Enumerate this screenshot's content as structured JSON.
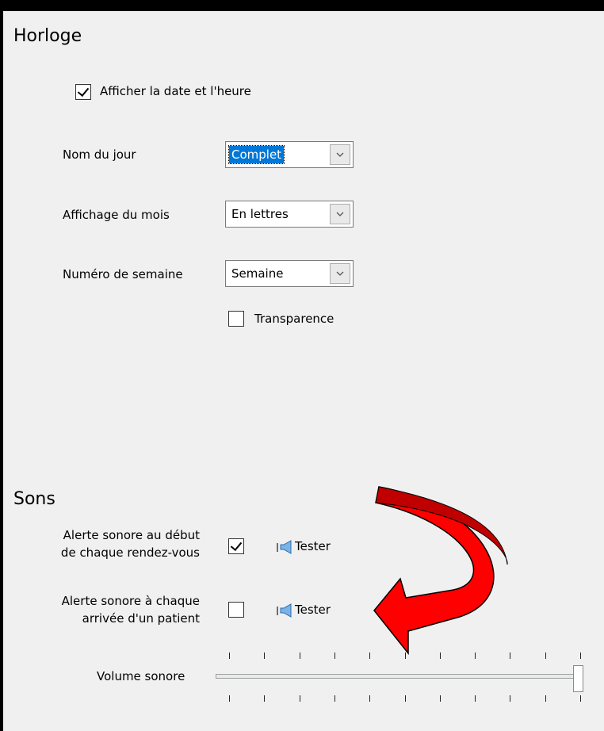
{
  "clock": {
    "title": "Horloge",
    "show_datetime_label": "Afficher la date et l'heure",
    "show_datetime_checked": true,
    "day_name_label": "Nom du jour",
    "day_name_value": "Complet",
    "month_label": "Affichage du mois",
    "month_value": "En lettres",
    "week_label": "Numéro de semaine",
    "week_value": "Semaine",
    "transparency_label": "Transparence",
    "transparency_checked": false
  },
  "sounds": {
    "title": "Sons",
    "alert_start_label_line1": "Alerte sonore au début",
    "alert_start_label_line2": "de chaque rendez-vous",
    "alert_start_checked": true,
    "alert_arrival_label_line1": "Alerte sonore à chaque",
    "alert_arrival_label_line2": "arrivée d'un patient",
    "alert_arrival_checked": false,
    "test_label": "Tester",
    "volume_label": "Volume sonore",
    "volume_level": 1.0
  },
  "annotation": {
    "arrow_color": "#ff0000",
    "arrow_dark_color": "#c00000"
  },
  "icons": {
    "dropdown": "chevron-down-icon",
    "speaker": "speaker-icon",
    "check": "checkmark-icon"
  }
}
